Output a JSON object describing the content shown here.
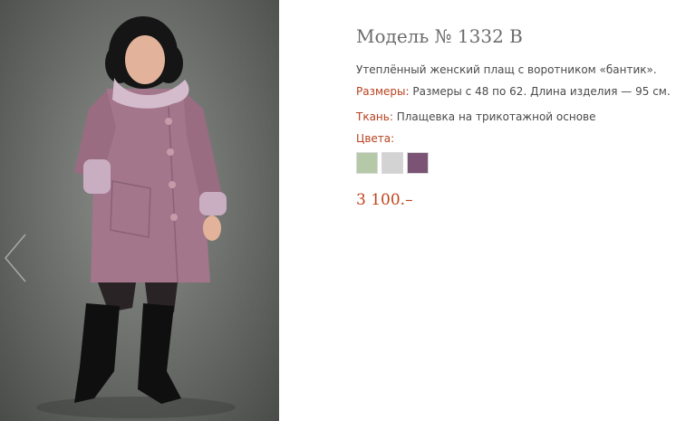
{
  "product": {
    "title": "Модель № 1332 В",
    "description": "Утеплённый женский плащ с воротником «бантик».",
    "sizes_label": "Размеры:",
    "sizes_value": " Размеры с 48 по 62. Длина изделия — 95 см.",
    "fabric_label": "Ткань:",
    "fabric_value": " Плащевка на трикотажной основе",
    "colors_label": "Цвета:",
    "colors": [
      "#b5c9a8",
      "#d3d3d3",
      "#7b5375"
    ],
    "price": "3 100.–"
  },
  "gallery": {
    "prev_icon": "chevron-left-icon"
  }
}
